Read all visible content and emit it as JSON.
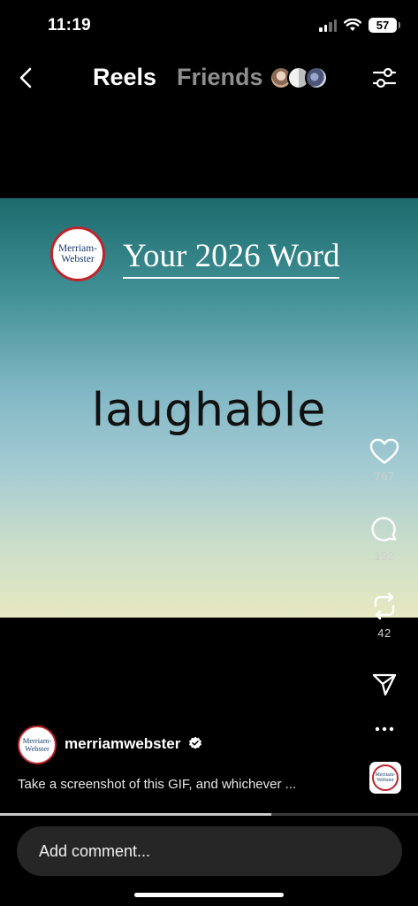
{
  "status_bar": {
    "time": "11:19",
    "battery": "57",
    "icons": [
      "signal-icon",
      "wifi-icon",
      "battery-icon"
    ]
  },
  "header": {
    "back_icon": "chevron-left-icon",
    "tabs": [
      {
        "label": "Reels",
        "active": true
      },
      {
        "label": "Friends",
        "active": false
      }
    ],
    "filter_icon": "sliders-icon"
  },
  "video": {
    "logo_lines": [
      "Merriam-",
      "Webster"
    ],
    "title": "Your 2026 Word",
    "word": "laughable",
    "progress": 0.65
  },
  "actions": [
    {
      "icon": "heart-icon",
      "count": "767"
    },
    {
      "icon": "comment-icon",
      "count": "192"
    },
    {
      "icon": "repost-icon",
      "count": "42"
    },
    {
      "icon": "send-icon",
      "count": ""
    },
    {
      "icon": "more-icon",
      "count": ""
    }
  ],
  "post": {
    "username": "merriamwebster",
    "verified": true,
    "caption": "Take a screenshot of this GIF, and whichever ..."
  },
  "comment": {
    "placeholder": "Add comment..."
  },
  "colors": {
    "brand_red": "#c0242b",
    "brand_blue": "#1a3d6e",
    "bar_bg": "#262626"
  }
}
